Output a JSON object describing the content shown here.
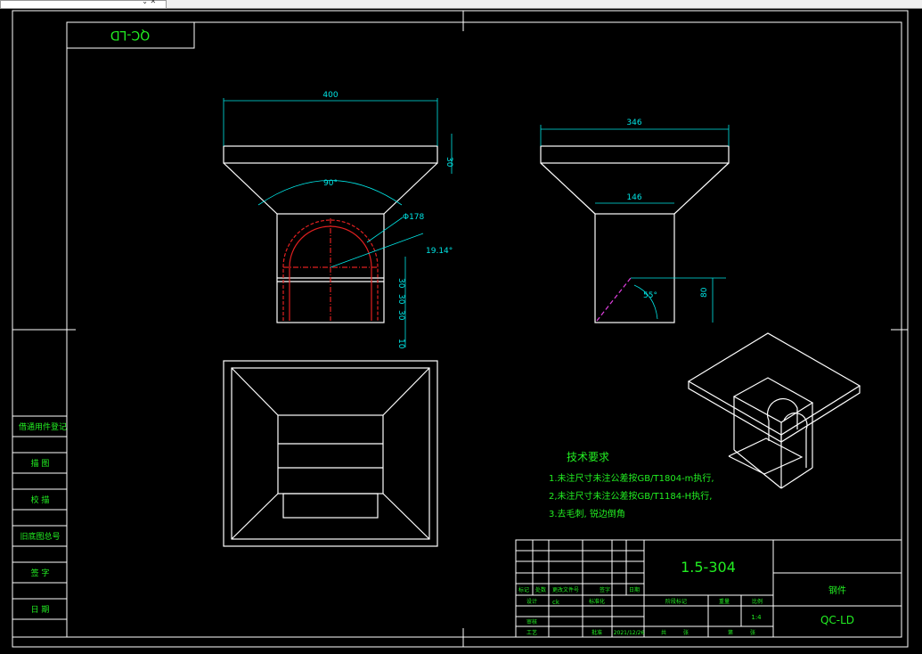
{
  "drawing_code_stamp": "QC-LD",
  "front_view": {
    "top_width": "400",
    "flange_height": "30",
    "angle": "90°",
    "hole_dia": "Φ178",
    "hole_angle": "19.14°",
    "dims_vertical": [
      "30",
      "30",
      "30",
      "10"
    ]
  },
  "side_view": {
    "top_width": "346",
    "bottom_width": "146",
    "angle": "55°",
    "height": "80"
  },
  "tech_requirements": {
    "title": "技术要求",
    "items": [
      "1.未注尺寸未注公差按GB/T1804-m执行,",
      "2,未注尺寸未注公差按GB/T1184-H执行,",
      "3.去毛刺, 锐边倒角"
    ]
  },
  "left_strip": [
    "借通用件登记",
    "描  图",
    "校  描",
    "旧底图总号",
    "签  字",
    "日  期"
  ],
  "title_block": {
    "part_number": "1.5-304",
    "material": "钢件",
    "code": "QC-LD",
    "scale": "1:4",
    "date": "2021/12/26",
    "designer": "ck",
    "header_labels": [
      "标记",
      "处数",
      "更改文件号",
      "签字",
      "日期"
    ],
    "row_labels": [
      "设计",
      "审核",
      "工艺"
    ],
    "labels_mid": [
      "标准化",
      "批准"
    ],
    "labels_right": [
      "阶段标记",
      "重量",
      "比例"
    ],
    "labels_bottom": [
      "共",
      "张",
      "第",
      "张"
    ]
  }
}
